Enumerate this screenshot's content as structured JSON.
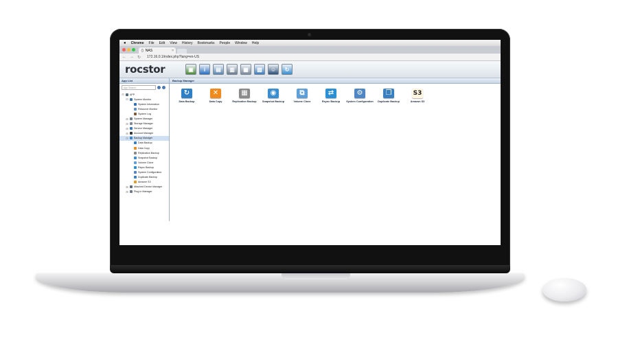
{
  "menubar": {
    "apple": "",
    "items": [
      "Chrome",
      "File",
      "Edit",
      "View",
      "History",
      "Bookmarks",
      "People",
      "Window",
      "Help"
    ]
  },
  "browser": {
    "tab_title": "NAS",
    "url": "172.16.0.1/index.php?lang=en-US"
  },
  "app": {
    "logo": "rocstor",
    "quick_icons": [
      "quick-icon",
      "info-icon",
      "grid-icon",
      "drives-icon",
      "storage-icon",
      "monitor-icon",
      "user-icon",
      "backup-icon"
    ]
  },
  "sidebar": {
    "header": "App List",
    "search_placeholder": "App Search",
    "tree": [
      {
        "label": "APP",
        "level": 0,
        "expander": "⊟",
        "color": "#5a6b7c"
      },
      {
        "label": "System Monitor",
        "level": 1,
        "expander": "⊟",
        "color": "#3f73b5"
      },
      {
        "label": "System Information",
        "level": 2,
        "expander": "",
        "color": "#2e6fc4"
      },
      {
        "label": "Resource Monitor",
        "level": 2,
        "expander": "",
        "color": "#5c8fca"
      },
      {
        "label": "System Log",
        "level": 2,
        "expander": "",
        "color": "#7c5a3a"
      },
      {
        "label": "System Manager",
        "level": 1,
        "expander": "⊞",
        "color": "#6f7f8f"
      },
      {
        "label": "Storage Manager",
        "level": 1,
        "expander": "⊞",
        "color": "#7d8896"
      },
      {
        "label": "Service Manager",
        "level": 1,
        "expander": "⊞",
        "color": "#3b78c2"
      },
      {
        "label": "Account Manager",
        "level": 1,
        "expander": "⊞",
        "color": "#333333"
      },
      {
        "label": "Backup Manager",
        "level": 1,
        "expander": "⊟",
        "color": "#3b85c8",
        "selected": true
      },
      {
        "label": "Data Backup",
        "level": 2,
        "expander": "",
        "color": "#2f7fc7"
      },
      {
        "label": "Data Copy",
        "level": 2,
        "expander": "",
        "color": "#f08a1c"
      },
      {
        "label": "Replication Backup",
        "level": 2,
        "expander": "",
        "color": "#8a8a8a"
      },
      {
        "label": "Snapshot Backup",
        "level": 2,
        "expander": "",
        "color": "#3a8ed0"
      },
      {
        "label": "Volume Clone",
        "level": 2,
        "expander": "",
        "color": "#5f9fd8"
      },
      {
        "label": "Rsync Backup",
        "level": 2,
        "expander": "",
        "color": "#2b8fd6"
      },
      {
        "label": "System Configuration",
        "level": 2,
        "expander": "",
        "color": "#4f86c4"
      },
      {
        "label": "Duplicate Backup",
        "level": 2,
        "expander": "",
        "color": "#3a7fbf"
      },
      {
        "label": "Amazon S3",
        "level": 2,
        "expander": "",
        "color": "#e79a22"
      },
      {
        "label": "Attached Device Manager",
        "level": 1,
        "expander": "⊞",
        "color": "#5b6b7b"
      },
      {
        "label": "Plug-In Manager",
        "level": 1,
        "expander": "⊞",
        "color": "#6a7a8a"
      }
    ]
  },
  "content": {
    "header": "Backup Manager",
    "apps": [
      {
        "label": "Data Backup",
        "icon": "data-backup-icon",
        "glyph": "↻",
        "color": "#2f7fc7"
      },
      {
        "label": "Data Copy",
        "icon": "data-copy-icon",
        "glyph": "✕",
        "color": "#f08a1c"
      },
      {
        "label": "Replication Backup",
        "icon": "replication-backup-icon",
        "glyph": "▦",
        "color": "#8a8a8a"
      },
      {
        "label": "Snapshot Backup",
        "icon": "snapshot-backup-icon",
        "glyph": "◉",
        "color": "#3a8ed0"
      },
      {
        "label": "Volume Clone",
        "icon": "volume-clone-icon",
        "glyph": "⧉",
        "color": "#5f9fd8"
      },
      {
        "label": "Rsync Backup",
        "icon": "rsync-backup-icon",
        "glyph": "⇄",
        "color": "#2b8fd6"
      },
      {
        "label": "System Configuration",
        "icon": "system-configuration-icon",
        "glyph": "⚙",
        "color": "#4f86c4"
      },
      {
        "label": "Duplicate Backup",
        "icon": "duplicate-backup-icon",
        "glyph": "❐",
        "color": "#3a7fbf"
      },
      {
        "label": "Amazon S3",
        "icon": "amazon-s3-icon",
        "glyph": "S3",
        "color": "#e79a22"
      }
    ]
  }
}
